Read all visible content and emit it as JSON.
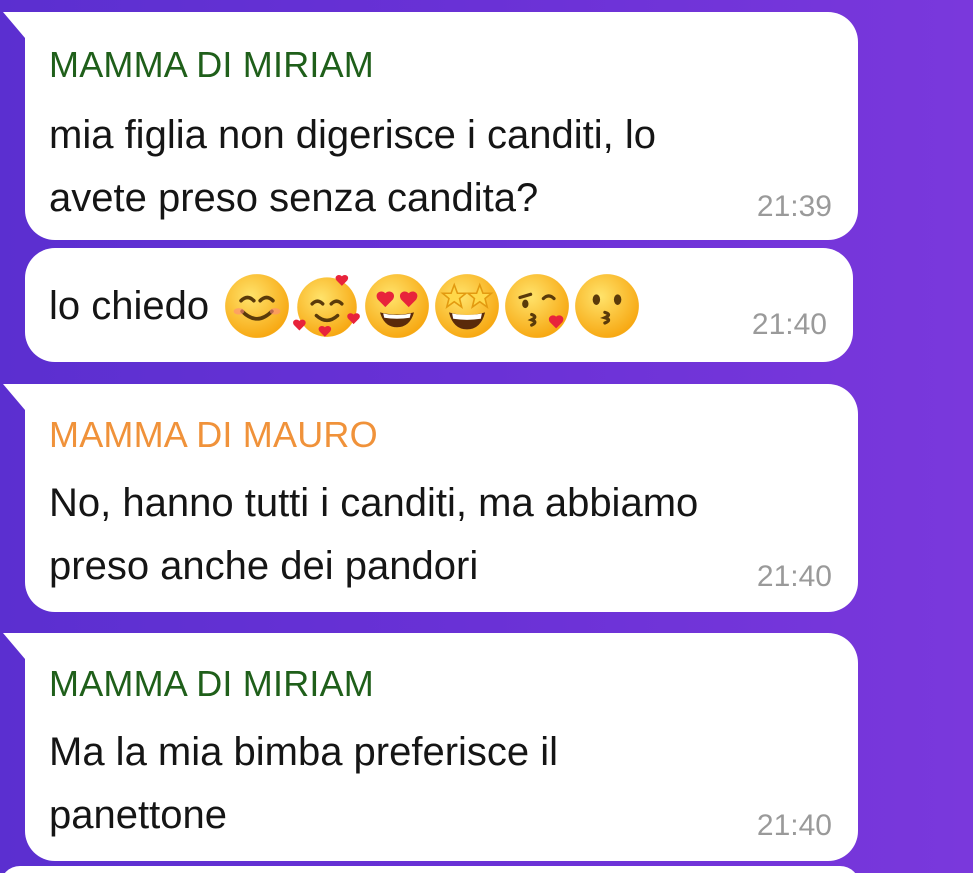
{
  "messages": [
    {
      "sender": "MAMMA DI MIRIAM",
      "sender_color": "#1f5f1a",
      "lines": [
        "mia figlia non digerisce i canditi, lo",
        "avete preso senza candita?"
      ],
      "time": "21:39"
    },
    {
      "text": "lo chiedo",
      "emojis": [
        "smiling-face-icon",
        "smiling-face-with-hearts-icon",
        "heart-eyes-icon",
        "star-struck-icon",
        "face-blowing-kiss-icon",
        "kissing-face-icon"
      ],
      "time": "21:40"
    },
    {
      "sender": "MAMMA DI MAURO",
      "sender_color": "#f0923a",
      "lines": [
        "No, hanno tutti i canditi, ma abbiamo",
        "preso anche dei pandori"
      ],
      "time": "21:40"
    },
    {
      "sender": "MAMMA DI MIRIAM",
      "sender_color": "#1f5f1a",
      "lines": [
        "Ma la mia bimba preferisce il",
        "panettone"
      ],
      "time": "21:40"
    }
  ],
  "colors": {
    "background": "#6a31d6",
    "bubble": "#ffffff",
    "timestamp": "#9a9a9a"
  }
}
